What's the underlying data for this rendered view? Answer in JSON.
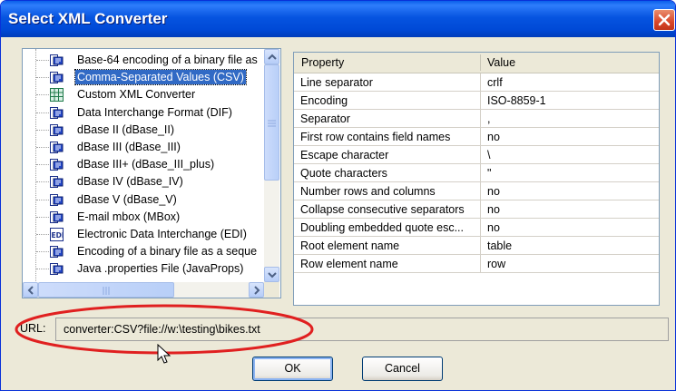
{
  "dialog": {
    "title": "Select XML Converter"
  },
  "converters": [
    {
      "label": "Base-64 encoding of a binary file as",
      "icon": "converter-icon",
      "selected": false
    },
    {
      "label": "Comma-Separated Values (CSV)",
      "icon": "converter-icon",
      "selected": true
    },
    {
      "label": "Custom XML Converter",
      "icon": "grid-icon",
      "selected": false
    },
    {
      "label": "Data Interchange Format (DIF)",
      "icon": "converter-icon",
      "selected": false
    },
    {
      "label": "dBase II (dBase_II)",
      "icon": "converter-icon",
      "selected": false
    },
    {
      "label": "dBase III (dBase_III)",
      "icon": "converter-icon",
      "selected": false
    },
    {
      "label": "dBase III+ (dBase_III_plus)",
      "icon": "converter-icon",
      "selected": false
    },
    {
      "label": "dBase IV (dBase_IV)",
      "icon": "converter-icon",
      "selected": false
    },
    {
      "label": "dBase V (dBase_V)",
      "icon": "converter-icon",
      "selected": false
    },
    {
      "label": "E-mail mbox (MBox)",
      "icon": "converter-icon",
      "selected": false
    },
    {
      "label": "Electronic Data Interchange (EDI)",
      "icon": "edi-icon",
      "selected": false
    },
    {
      "label": "Encoding of a binary file as a seque",
      "icon": "converter-icon",
      "selected": false
    },
    {
      "label": "Java .properties File (JavaProps)",
      "icon": "converter-icon",
      "selected": false
    }
  ],
  "properties": {
    "header_property": "Property",
    "header_value": "Value",
    "rows": [
      {
        "name": "Line separator",
        "value": "crlf"
      },
      {
        "name": "Encoding",
        "value": "ISO-8859-1"
      },
      {
        "name": "Separator",
        "value": ","
      },
      {
        "name": "First row contains field names",
        "value": "no"
      },
      {
        "name": "Escape character",
        "value": "\\"
      },
      {
        "name": "Quote characters",
        "value": "\""
      },
      {
        "name": "Number rows and columns",
        "value": "no"
      },
      {
        "name": "Collapse consecutive separators",
        "value": "no"
      },
      {
        "name": "Doubling embedded quote esc...",
        "value": "no"
      },
      {
        "name": "Root element name",
        "value": "table"
      },
      {
        "name": "Row element name",
        "value": "row"
      }
    ]
  },
  "url": {
    "label": "URL:",
    "value": "converter:CSV?file://w:\\testing\\bikes.txt"
  },
  "buttons": {
    "ok": "OK",
    "cancel": "Cancel"
  },
  "colors": {
    "titlebar": "#0054e3",
    "selection": "#316ac5",
    "annotation": "#e02020",
    "dialog_bg": "#ece9d8"
  }
}
